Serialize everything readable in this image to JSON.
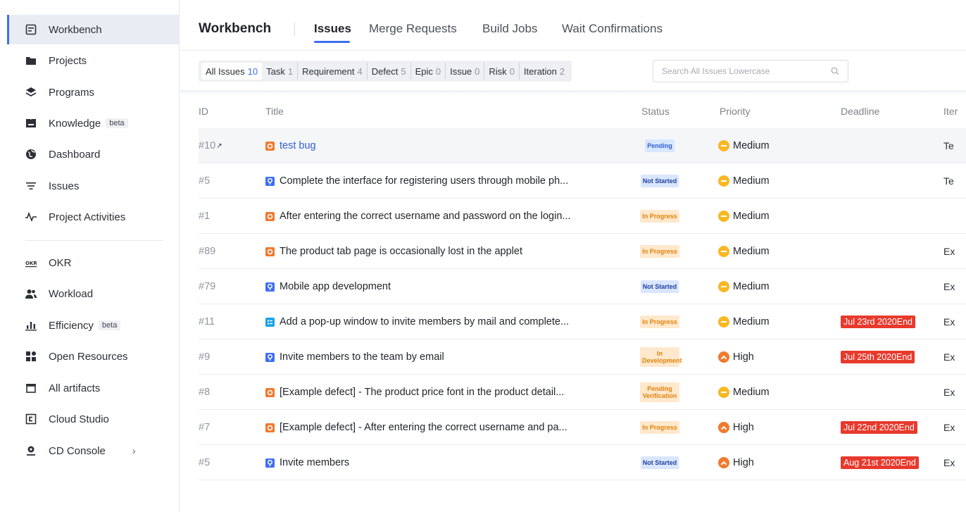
{
  "sidebar": {
    "items": [
      {
        "label": "Workbench",
        "icon": "workbench-icon",
        "active": true
      },
      {
        "label": "Projects",
        "icon": "folder-icon"
      },
      {
        "label": "Programs",
        "icon": "layers-icon"
      },
      {
        "label": "Knowledge",
        "icon": "book-icon",
        "badge": "beta"
      },
      {
        "label": "Dashboard",
        "icon": "globe-icon"
      },
      {
        "label": "Issues",
        "icon": "filter-list-icon"
      },
      {
        "label": "Project Activities",
        "icon": "activity-pulse-icon"
      },
      {
        "label": "OKR",
        "icon": "okr-icon"
      },
      {
        "label": "Workload",
        "icon": "users-icon"
      },
      {
        "label": "Efficiency",
        "icon": "bar-chart-icon",
        "badge": "beta"
      },
      {
        "label": "Open Resources",
        "icon": "grid-apps-icon"
      },
      {
        "label": "All artifacts",
        "icon": "artifact-box-icon"
      },
      {
        "label": "Cloud Studio",
        "icon": "cloud-studio-icon"
      },
      {
        "label": "CD Console",
        "icon": "cd-console-icon",
        "chevron": "›"
      }
    ]
  },
  "header": {
    "title": "Workbench",
    "tabs": [
      {
        "label": "Issues",
        "active": true
      },
      {
        "label": "Merge Requests"
      },
      {
        "label": "Build Jobs"
      },
      {
        "label": "Wait Confirmations"
      }
    ]
  },
  "filters": [
    {
      "label": "All Issues",
      "count": "10",
      "active": true
    },
    {
      "label": "Task",
      "count": "1"
    },
    {
      "label": "Requirement",
      "count": "4"
    },
    {
      "label": "Defect",
      "count": "5"
    },
    {
      "label": "Epic",
      "count": "0"
    },
    {
      "label": "Issue",
      "count": "0"
    },
    {
      "label": "Risk",
      "count": "0"
    },
    {
      "label": "Iteration",
      "count": "2"
    }
  ],
  "search": {
    "placeholder": "Search All Issues Lowercase"
  },
  "table": {
    "columns": {
      "id": "ID",
      "title": "Title",
      "status": "Status",
      "priority": "Priority",
      "deadline": "Deadline",
      "iteration": "Iter"
    },
    "rows": [
      {
        "id": "#10",
        "type": "defect",
        "title": "test bug",
        "status": "Pending",
        "priority": "Medium",
        "deadline": "",
        "iteration": "Te",
        "link": true
      },
      {
        "id": "#5",
        "type": "requirement",
        "title": "Complete the interface for registering users through mobile ph...",
        "status": "Not Started",
        "priority": "Medium",
        "deadline": "",
        "iteration": "Te"
      },
      {
        "id": "#1",
        "type": "defect",
        "title": "After entering the correct username and password on the login...",
        "status": "In Progress",
        "priority": "Medium",
        "deadline": "",
        "iteration": ""
      },
      {
        "id": "#89",
        "type": "defect",
        "title": "The product tab page is occasionally lost in the applet",
        "status": "In Progress",
        "priority": "Medium",
        "deadline": "",
        "iteration": "Ex"
      },
      {
        "id": "#79",
        "type": "requirement",
        "title": "Mobile app development",
        "status": "Not Started",
        "priority": "Medium",
        "deadline": "",
        "iteration": "Ex"
      },
      {
        "id": "#11",
        "type": "task",
        "title": "Add a pop-up window to invite members by mail and complete...",
        "status": "In Progress",
        "priority": "Medium",
        "deadline": "Jul 23rd 2020End",
        "iteration": "Ex"
      },
      {
        "id": "#9",
        "type": "requirement",
        "title": "Invite members to the team by email",
        "status": "In Development",
        "priority": "High",
        "deadline": "Jul 25th 2020End",
        "iteration": "Ex"
      },
      {
        "id": "#8",
        "type": "defect",
        "title": "[Example defect] - The product price font in the product detail...",
        "status": "Pending Verification",
        "priority": "Medium",
        "deadline": "",
        "iteration": "Ex"
      },
      {
        "id": "#7",
        "type": "defect",
        "title": "[Example defect] - After entering the correct username and pa...",
        "status": "In Progress",
        "priority": "High",
        "deadline": "Jul 22nd 2020End",
        "iteration": "Ex"
      },
      {
        "id": "#5",
        "type": "requirement",
        "title": "Invite members",
        "status": "Not Started",
        "priority": "High",
        "deadline": "Aug 21st 2020End",
        "iteration": "Ex"
      }
    ]
  },
  "colors": {
    "accent": "#3d6ef5",
    "defect": "#f07a2d",
    "requirement": "#3d6ef5",
    "task": "#1aa3e8",
    "medium": "#f8b824",
    "high": "#f07a2d",
    "deadline": "#e8392d"
  }
}
